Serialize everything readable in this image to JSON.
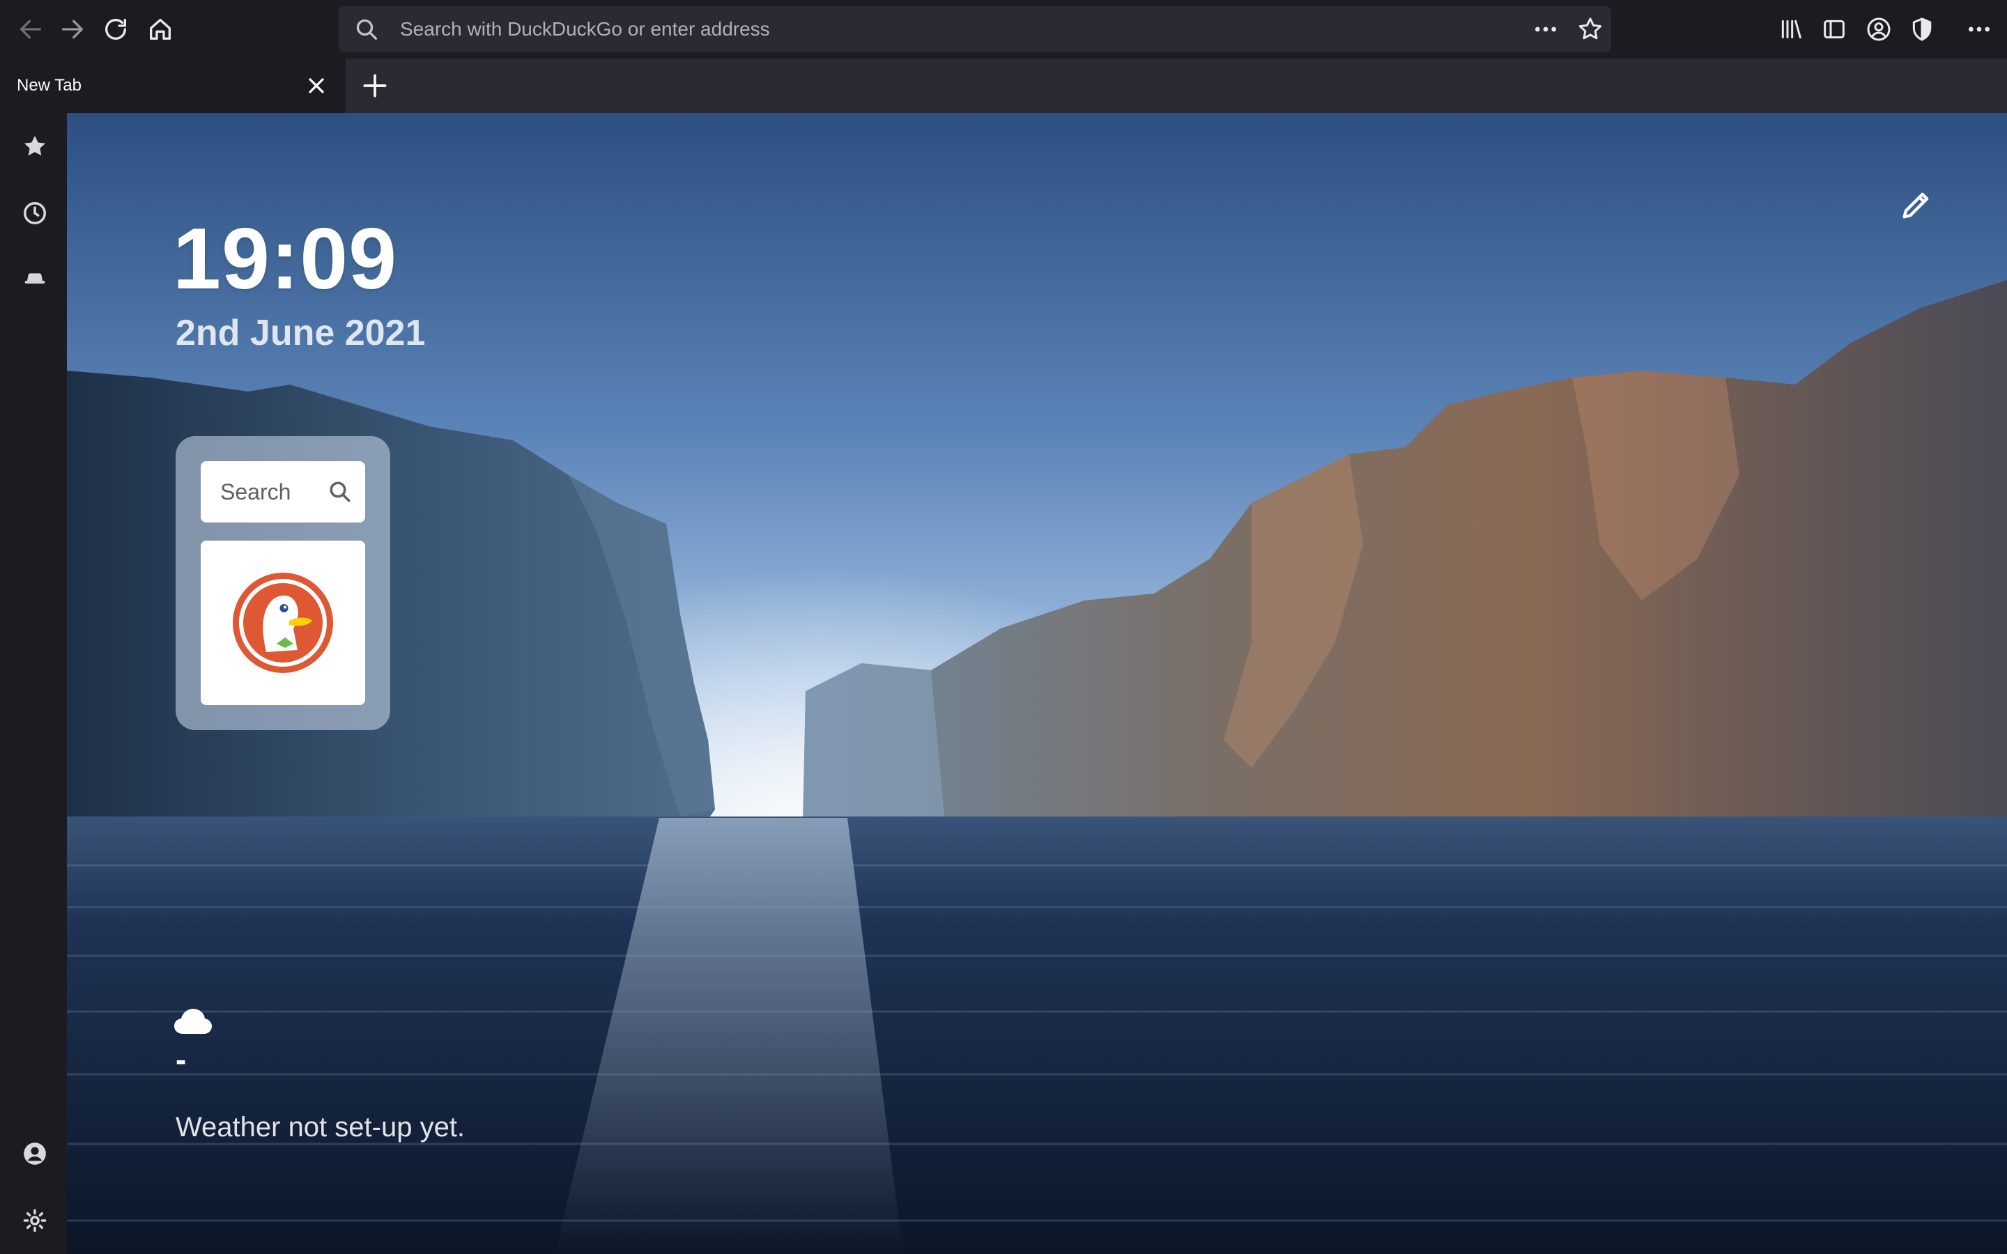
{
  "browser": {
    "url_placeholder": "Search with DuckDuckGo or enter address",
    "tab_title": "New Tab",
    "toolbar_icons": [
      "back-icon",
      "forward-icon",
      "reload-icon",
      "home-icon",
      "page-actions-icon",
      "bookmark-star-icon",
      "library-icon",
      "sidebar-toggle-icon",
      "account-icon",
      "shield-icon",
      "menu-icon"
    ]
  },
  "sidebar": {
    "top_icons": [
      "star-icon",
      "history-icon",
      "hat-icon"
    ],
    "bottom_icons": [
      "account-icon",
      "settings-icon"
    ]
  },
  "newtab": {
    "time": "19:09",
    "date": "2nd June 2021",
    "search_placeholder": "Search",
    "tile": {
      "name": "DuckDuckGo",
      "icon": "duckduckgo-logo"
    },
    "weather": {
      "icon": "cloud-icon",
      "temperature": "-",
      "status": "Weather not set-up yet."
    }
  },
  "colors": {
    "chrome_dark": "#1c1b22",
    "tab_strip": "#2b2a33",
    "url_bar": "#2b2a33",
    "ddg_orange": "#de5833"
  }
}
